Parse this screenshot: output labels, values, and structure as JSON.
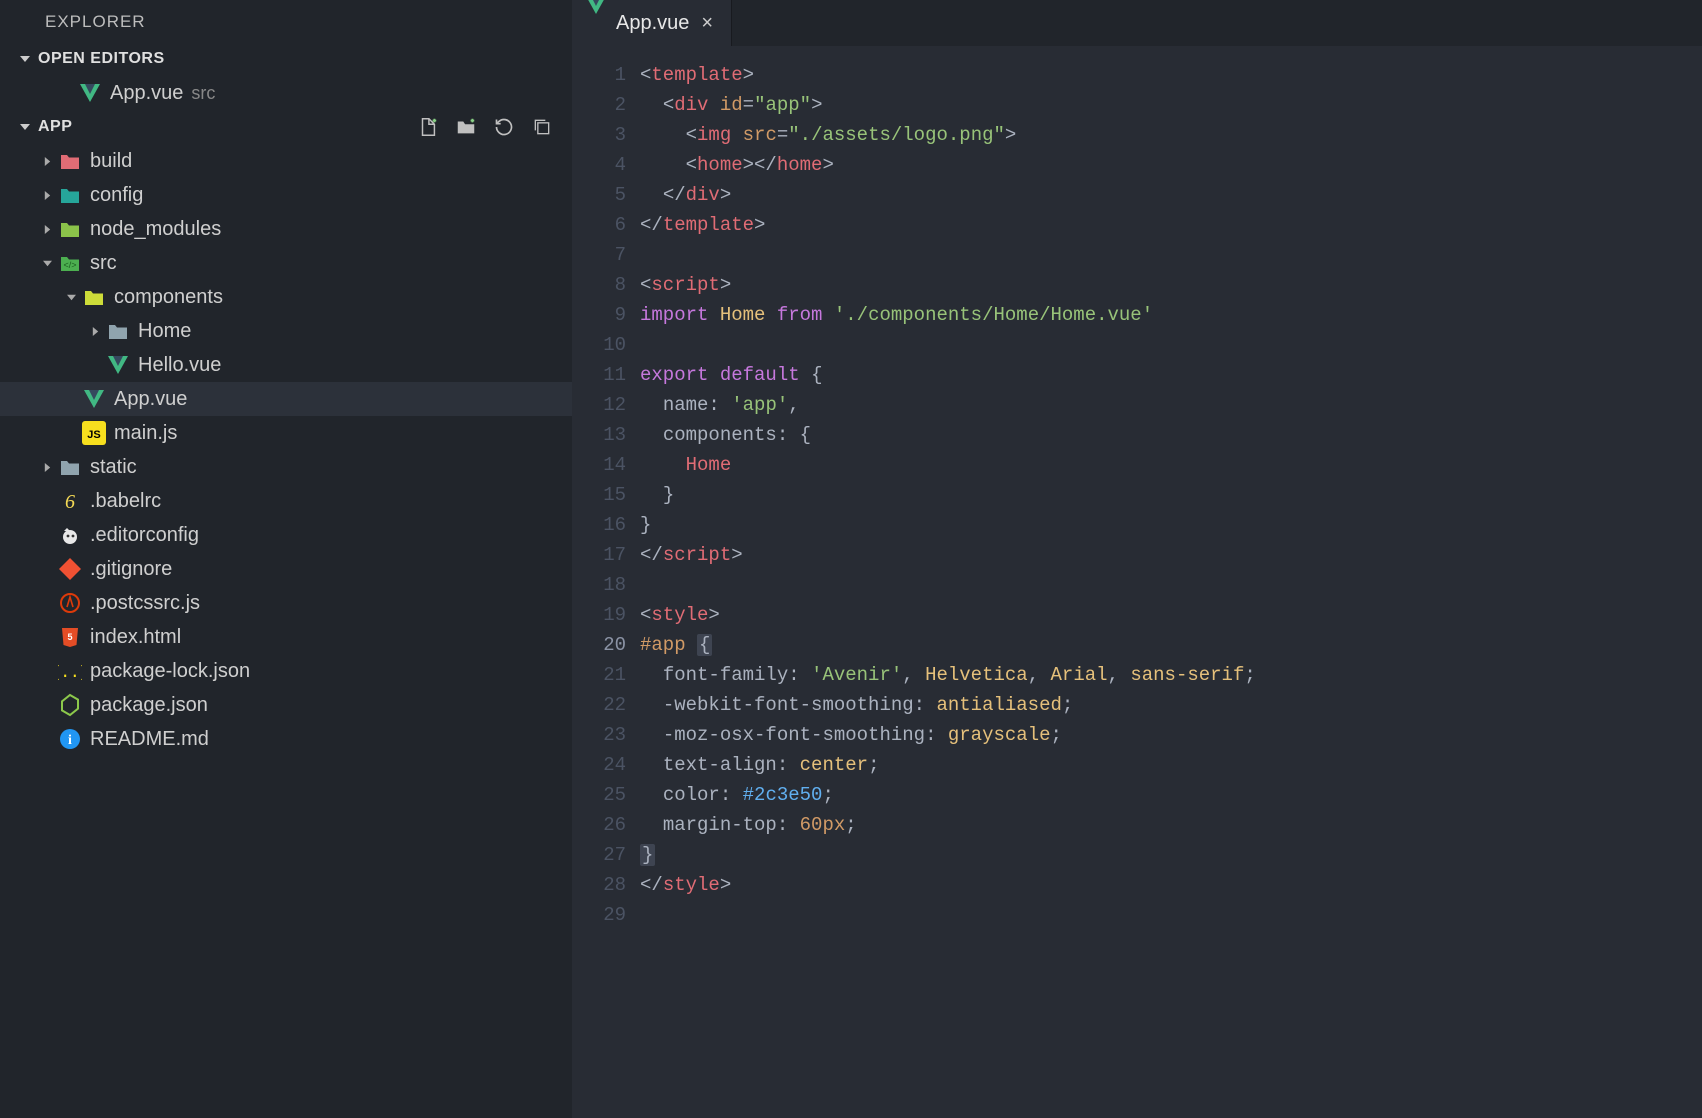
{
  "sidebar": {
    "title": "EXPLORER",
    "sections": {
      "openEditors": {
        "label": "OPEN EDITORS",
        "items": [
          {
            "label": "App.vue",
            "meta": "src",
            "iconType": "vue"
          }
        ]
      },
      "project": {
        "label": "APP",
        "actions": [
          "new-file",
          "new-folder",
          "refresh",
          "collapse-all"
        ],
        "tree": [
          {
            "indent": 0,
            "chev": "right",
            "iconType": "folder-red",
            "label": "build"
          },
          {
            "indent": 0,
            "chev": "right",
            "iconType": "folder-teal",
            "label": "config"
          },
          {
            "indent": 0,
            "chev": "right",
            "iconType": "folder-green",
            "label": "node_modules"
          },
          {
            "indent": 0,
            "chev": "down",
            "iconType": "folder-src",
            "label": "src"
          },
          {
            "indent": 1,
            "chev": "down",
            "iconType": "folder-comp",
            "label": "components"
          },
          {
            "indent": 2,
            "chev": "right",
            "iconType": "folder-grey",
            "label": "Home"
          },
          {
            "indent": 2,
            "chev": "none",
            "iconType": "vue",
            "label": "Hello.vue"
          },
          {
            "indent": 1,
            "chev": "none",
            "iconType": "vue",
            "label": "App.vue",
            "selected": true
          },
          {
            "indent": 1,
            "chev": "none",
            "iconType": "js",
            "label": "main.js"
          },
          {
            "indent": 0,
            "chev": "right",
            "iconType": "folder-grey",
            "label": "static"
          },
          {
            "indent": 0,
            "chev": "none",
            "iconType": "babel",
            "label": ".babelrc"
          },
          {
            "indent": 0,
            "chev": "none",
            "iconType": "editorconfig",
            "label": ".editorconfig"
          },
          {
            "indent": 0,
            "chev": "none",
            "iconType": "git",
            "label": ".gitignore"
          },
          {
            "indent": 0,
            "chev": "none",
            "iconType": "postcss",
            "label": ".postcssrc.js"
          },
          {
            "indent": 0,
            "chev": "none",
            "iconType": "html",
            "label": "index.html"
          },
          {
            "indent": 0,
            "chev": "none",
            "iconType": "json",
            "label": "package-lock.json"
          },
          {
            "indent": 0,
            "chev": "none",
            "iconType": "node",
            "label": "package.json"
          },
          {
            "indent": 0,
            "chev": "none",
            "iconType": "info",
            "label": "README.md"
          }
        ]
      }
    }
  },
  "tabs": [
    {
      "label": "App.vue",
      "iconType": "vue",
      "active": true
    }
  ],
  "editor": {
    "activeLine": 20,
    "lines": [
      [
        [
          "punc",
          "<"
        ],
        [
          "tag",
          "template"
        ],
        [
          "punc",
          ">"
        ]
      ],
      [
        [
          "ind",
          "  "
        ],
        [
          "punc",
          "<"
        ],
        [
          "tag",
          "div"
        ],
        [
          "txt",
          " "
        ],
        [
          "attr",
          "id"
        ],
        [
          "punc",
          "="
        ],
        [
          "str",
          "\"app\""
        ],
        [
          "punc",
          ">"
        ]
      ],
      [
        [
          "ind",
          "    "
        ],
        [
          "punc",
          "<"
        ],
        [
          "tag",
          "img"
        ],
        [
          "txt",
          " "
        ],
        [
          "attr",
          "src"
        ],
        [
          "punc",
          "="
        ],
        [
          "str",
          "\"./assets/logo.png\""
        ],
        [
          "punc",
          ">"
        ]
      ],
      [
        [
          "ind",
          "    "
        ],
        [
          "punc",
          "<"
        ],
        [
          "tag",
          "home"
        ],
        [
          "punc",
          "></"
        ],
        [
          "tag",
          "home"
        ],
        [
          "punc",
          ">"
        ]
      ],
      [
        [
          "ind",
          "  "
        ],
        [
          "punc",
          "</"
        ],
        [
          "tag",
          "div"
        ],
        [
          "punc",
          ">"
        ]
      ],
      [
        [
          "punc",
          "</"
        ],
        [
          "tag",
          "template"
        ],
        [
          "punc",
          ">"
        ]
      ],
      [],
      [
        [
          "punc",
          "<"
        ],
        [
          "tag",
          "script"
        ],
        [
          "punc",
          ">"
        ]
      ],
      [
        [
          "kw",
          "import"
        ],
        [
          "txt",
          " "
        ],
        [
          "cls",
          "Home"
        ],
        [
          "txt",
          " "
        ],
        [
          "kw",
          "from"
        ],
        [
          "txt",
          " "
        ],
        [
          "str",
          "'./components/Home/Home.vue'"
        ]
      ],
      [],
      [
        [
          "kw",
          "export"
        ],
        [
          "txt",
          " "
        ],
        [
          "kw",
          "default"
        ],
        [
          "txt",
          " "
        ],
        [
          "punc",
          "{"
        ]
      ],
      [
        [
          "ind",
          "  "
        ],
        [
          "txt",
          "name"
        ],
        [
          "punc",
          ":"
        ],
        [
          "txt",
          " "
        ],
        [
          "str",
          "'app'"
        ],
        [
          "punc",
          ","
        ]
      ],
      [
        [
          "ind",
          "  "
        ],
        [
          "txt",
          "components"
        ],
        [
          "punc",
          ":"
        ],
        [
          "txt",
          " "
        ],
        [
          "punc",
          "{"
        ]
      ],
      [
        [
          "ind",
          "    "
        ],
        [
          "tag",
          "Home"
        ]
      ],
      [
        [
          "ind",
          "  "
        ],
        [
          "punc",
          "}"
        ]
      ],
      [
        [
          "punc",
          "}"
        ]
      ],
      [
        [
          "punc",
          "</"
        ],
        [
          "tag",
          "script"
        ],
        [
          "punc",
          ">"
        ]
      ],
      [],
      [
        [
          "punc",
          "<"
        ],
        [
          "tag",
          "style"
        ],
        [
          "punc",
          ">"
        ]
      ],
      [
        [
          "sel",
          "#app "
        ],
        [
          "braceHL",
          "{"
        ]
      ],
      [
        [
          "ind",
          "  "
        ],
        [
          "txt",
          "font-family"
        ],
        [
          "punc",
          ":"
        ],
        [
          "txt",
          " "
        ],
        [
          "str",
          "'Avenir'"
        ],
        [
          "punc",
          ","
        ],
        [
          "txt",
          " "
        ],
        [
          "cls",
          "Helvetica"
        ],
        [
          "punc",
          ","
        ],
        [
          "txt",
          " "
        ],
        [
          "cls",
          "Arial"
        ],
        [
          "punc",
          ","
        ],
        [
          "txt",
          " "
        ],
        [
          "cls",
          "sans-serif"
        ],
        [
          "punc",
          ";"
        ]
      ],
      [
        [
          "ind",
          "  "
        ],
        [
          "txt",
          "-webkit-font-smoothing"
        ],
        [
          "punc",
          ":"
        ],
        [
          "txt",
          " "
        ],
        [
          "cls",
          "antialiased"
        ],
        [
          "punc",
          ";"
        ]
      ],
      [
        [
          "ind",
          "  "
        ],
        [
          "txt",
          "-moz-osx-font-smoothing"
        ],
        [
          "punc",
          ":"
        ],
        [
          "txt",
          " "
        ],
        [
          "cls",
          "grayscale"
        ],
        [
          "punc",
          ";"
        ]
      ],
      [
        [
          "ind",
          "  "
        ],
        [
          "txt",
          "text-align"
        ],
        [
          "punc",
          ":"
        ],
        [
          "txt",
          " "
        ],
        [
          "cls",
          "center"
        ],
        [
          "punc",
          ";"
        ]
      ],
      [
        [
          "ind",
          "  "
        ],
        [
          "txt",
          "color"
        ],
        [
          "punc",
          ":"
        ],
        [
          "txt",
          " "
        ],
        [
          "fn",
          "#2c3e50"
        ],
        [
          "punc",
          ";"
        ]
      ],
      [
        [
          "ind",
          "  "
        ],
        [
          "txt",
          "margin-top"
        ],
        [
          "punc",
          ":"
        ],
        [
          "txt",
          " "
        ],
        [
          "attr",
          "60px"
        ],
        [
          "punc",
          ";"
        ]
      ],
      [
        [
          "braceHL",
          "}"
        ]
      ],
      [
        [
          "punc",
          "</"
        ],
        [
          "tag",
          "style"
        ],
        [
          "punc",
          ">"
        ]
      ],
      []
    ]
  }
}
